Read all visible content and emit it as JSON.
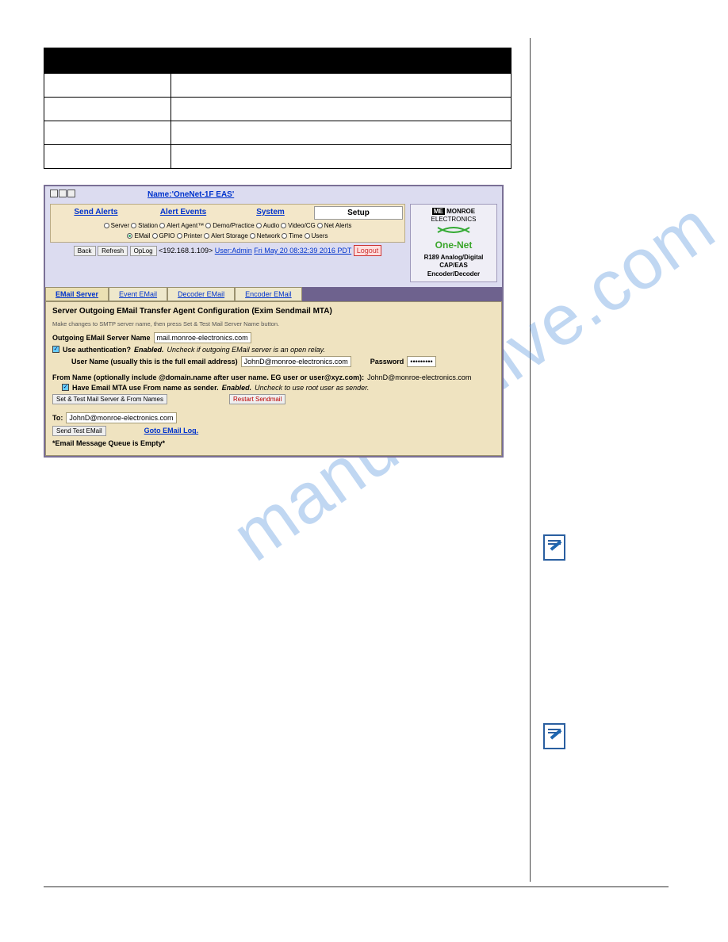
{
  "watermark": "manualshive.com",
  "table": {
    "header": "",
    "rows": [
      {
        "l": "",
        "r": "",
        "tall": false
      },
      {
        "l": "",
        "r": "",
        "tall": true
      },
      {
        "l": "",
        "r": "",
        "tall": false
      },
      {
        "l": "",
        "r": "",
        "tall": false
      }
    ]
  },
  "section_heading": "",
  "ui": {
    "name_label": "Name:'OneNet-1F EAS'",
    "tabs": {
      "send_alerts": "Send Alerts",
      "alert_events": "Alert Events",
      "system": "System",
      "setup": "Setup"
    },
    "radio_row_a": [
      "Server",
      "Station",
      "Alert Agent™",
      "Demo/Practice",
      "Audio",
      "Video/CG",
      "Net Alerts"
    ],
    "radio_row_b": [
      "EMail",
      "GPIO",
      "Printer",
      "Alert Storage",
      "Network",
      "Time",
      "Users"
    ],
    "toolbar": {
      "back": "Back",
      "refresh": "Refresh",
      "oplog": "OpLog",
      "ip": "<192.168.1.109>",
      "useradmin": "User:Admin",
      "timestamp": "Fri May 20 08:32:39 2016 PDT",
      "logout": "Logout"
    },
    "brand": {
      "me": "ME",
      "monroe1": "MONROE",
      "monroe2": "ELECTRONICS",
      "onenet": "One-Net",
      "model": "R189 Analog/Digital",
      "capeas": "CAP/EAS",
      "encdec": "Encoder/Decoder"
    },
    "subtabs": {
      "email_server": "EMail Server",
      "event_email": "Event EMail",
      "decoder_email": "Decoder EMail",
      "encoder_email": "Encoder EMail"
    },
    "cfg": {
      "title": "Server Outgoing EMail Transfer Agent Configuration (Exim Sendmail MTA)",
      "note": "Make changes to SMTP server name, then press Set & Test Mail Server Name button.",
      "out_name_label": "Outgoing EMail Server Name",
      "out_name_value": "mail.monroe-electronics.com",
      "use_auth_label": "Use authentication?",
      "enabled": "Enabled.",
      "use_auth_hint": "Uncheck if outgoing EMail server is an open relay.",
      "user_label": "User Name (usually this is the full email address)",
      "user_value": "JohnD@monroe-electronics.com",
      "pass_label": "Password",
      "pass_value": "•••••••••",
      "from_label_a": "From Name (optionally include @domain.name after user name. EG user or user@xyz.com):",
      "from_value": "JohnD@monroe-electronics.com",
      "mta_label": "Have Email MTA use From name as sender.",
      "mta_hint": "Uncheck to use root user as sender.",
      "btn_set": "Set & Test Mail Server & From Names",
      "btn_restart": "Restart Sendmail",
      "to_label": "To:",
      "to_value": "JohnD@monroe-electronics.com",
      "btn_send_test": "Send Test EMail",
      "goto_log": "Goto EMail Log.",
      "queue": "*Email Message Queue is Empty*"
    }
  }
}
